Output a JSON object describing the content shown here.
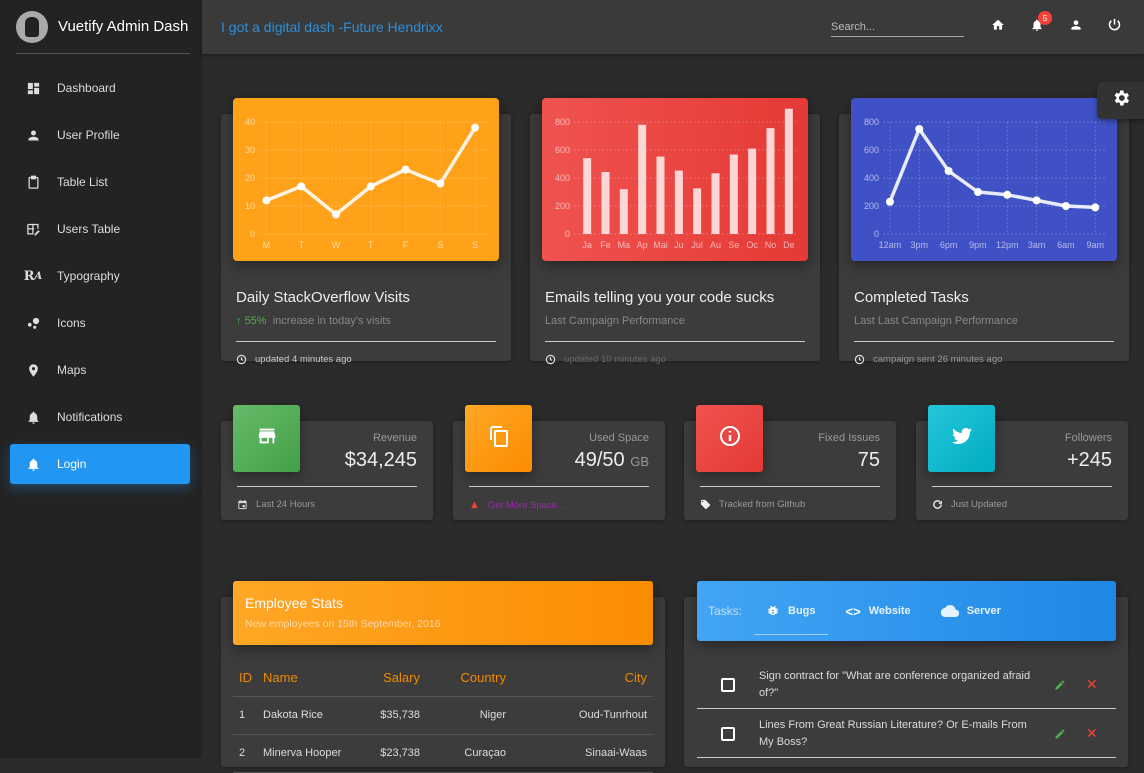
{
  "sidebar": {
    "title": "Vuetify Admin Dash",
    "items": [
      {
        "label": "Dashboard",
        "icon": "dashboard-icon"
      },
      {
        "label": "User Profile",
        "icon": "person-icon"
      },
      {
        "label": "Table List",
        "icon": "clipboard-icon"
      },
      {
        "label": "Users Table",
        "icon": "table-edit-icon"
      },
      {
        "label": "Typography",
        "icon": "typography-icon"
      },
      {
        "label": "Icons",
        "icon": "bubbles-icon"
      },
      {
        "label": "Maps",
        "icon": "map-pin-icon"
      },
      {
        "label": "Notifications",
        "icon": "bell-icon"
      },
      {
        "label": "Login",
        "icon": "bell-icon",
        "active": true
      }
    ]
  },
  "topbar": {
    "quote": "I got a digital dash -Future Hendrixx",
    "search_placeholder": "Search...",
    "notification_count": "5"
  },
  "colors": {
    "accent": "#2196f3",
    "orange": "#ff9800",
    "red": "#f44336",
    "indigo": "#3f51b5",
    "green": "#4caf50",
    "cyan": "#00bcd4"
  },
  "chart_cards": [
    {
      "title": "Daily StackOverflow Visits",
      "sub_highlight": "55%",
      "sub": "increase in today's visits",
      "footer": "updated 4 minutes ago"
    },
    {
      "title": "Emails telling you your code sucks",
      "sub": "Last Campaign Performance",
      "footer": "updated 10 minutes ago"
    },
    {
      "title": "Completed Tasks",
      "sub": "Last Last Campaign Performance",
      "footer": "campaign sent 26 minutes ago"
    }
  ],
  "chart_data": [
    {
      "type": "line",
      "categories": [
        "M",
        "T",
        "W",
        "T",
        "F",
        "S",
        "S"
      ],
      "values": [
        12,
        17,
        7,
        17,
        23,
        18,
        38
      ],
      "ylim": [
        0,
        40
      ],
      "yticks": [
        0,
        10,
        20,
        30,
        40
      ],
      "title": "Daily StackOverflow Visits"
    },
    {
      "type": "bar",
      "categories": [
        "Ja",
        "Fe",
        "Ma",
        "Ap",
        "Mai",
        "Ju",
        "Jul",
        "Au",
        "Se",
        "Oc",
        "No",
        "De"
      ],
      "values": [
        542,
        443,
        320,
        780,
        553,
        453,
        326,
        434,
        568,
        610,
        756,
        895
      ],
      "ylim": [
        0,
        800
      ],
      "yticks": [
        0,
        200,
        400,
        600,
        800
      ],
      "title": "Emails telling you your code sucks"
    },
    {
      "type": "line",
      "categories": [
        "12am",
        "3pm",
        "6pm",
        "9pm",
        "12pm",
        "3am",
        "6am",
        "9am"
      ],
      "values": [
        230,
        750,
        450,
        300,
        280,
        240,
        200,
        190
      ],
      "ylim": [
        0,
        800
      ],
      "yticks": [
        0,
        200,
        400,
        600,
        800
      ],
      "title": "Completed Tasks"
    }
  ],
  "stats": [
    {
      "label": "Revenue",
      "value": "$34,245",
      "unit": "",
      "footer": "Last 24 Hours",
      "icon": "store-icon",
      "footer_icon": "calendar-icon"
    },
    {
      "label": "Used Space",
      "value": "49/50",
      "unit": "GB",
      "footer": "Get More Space...",
      "icon": "copy-icon",
      "footer_icon": "warning-icon"
    },
    {
      "label": "Fixed Issues",
      "value": "75",
      "unit": "",
      "footer": "Tracked from Github",
      "icon": "info-icon",
      "footer_icon": "tag-icon"
    },
    {
      "label": "Followers",
      "value": "+245",
      "unit": "",
      "footer": "Just Updated",
      "icon": "twitter-icon",
      "footer_icon": "refresh-icon"
    }
  ],
  "employees": {
    "title": "Employee Stats",
    "subtitle": "New employees on 15th September, 2016",
    "headers": [
      "ID",
      "Name",
      "Salary",
      "Country",
      "City"
    ],
    "rows": [
      [
        "1",
        "Dakota Rice",
        "$35,738",
        "Niger",
        "Oud-Tunrhout"
      ],
      [
        "2",
        "Minerva Hooper",
        "$23,738",
        "Curaçao",
        "Sinaai-Waas"
      ]
    ]
  },
  "tasks": {
    "label": "Tasks:",
    "tabs": [
      {
        "label": "Bugs",
        "icon": "bug-icon",
        "active": true
      },
      {
        "label": "Website",
        "icon": "code-icon"
      },
      {
        "label": "Server",
        "icon": "cloud-icon"
      }
    ],
    "items": [
      {
        "text": "Sign contract for \"What are conference organized afraid of?\"",
        "checked": false
      },
      {
        "text": "Lines From Great Russian Literature? Or E-mails From My Boss?",
        "checked": false
      }
    ]
  }
}
